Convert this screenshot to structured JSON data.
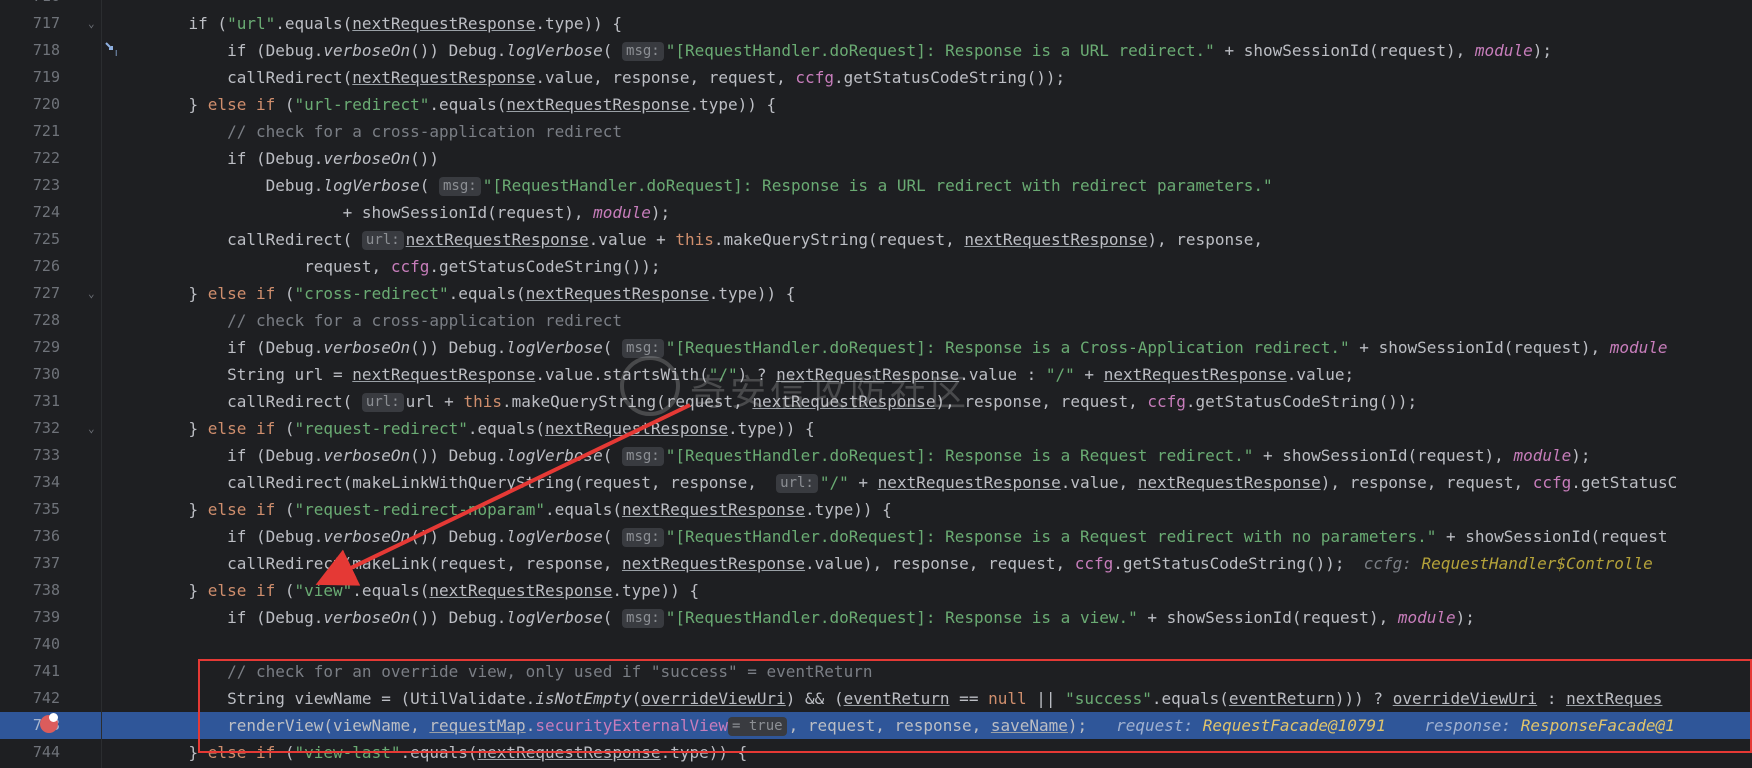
{
  "editor": {
    "lines": [
      {
        "n": "717",
        "segs": [
          [
            "",
            "    if ("
          ],
          [
            "str",
            "\"url\""
          ],
          [
            "",
            ".equals("
          ],
          [
            "u",
            "nextRequestResponse"
          ],
          [
            "",
            ".type)) {"
          ]
        ]
      },
      {
        "n": "718",
        "segs": [
          [
            "",
            "        if (Debug."
          ],
          [
            "ital",
            "verboseOn"
          ],
          [
            "",
            "()) Debug."
          ],
          [
            "ital",
            "logVerbose"
          ],
          [
            "",
            "( "
          ],
          [
            "hint",
            "msg:"
          ],
          [
            "str",
            "\"[RequestHandler.doRequest]: Response is a URL redirect.\""
          ],
          [
            "",
            " + showSessionId(request), "
          ],
          [
            "fld ital",
            "module"
          ],
          [
            "",
            ");"
          ]
        ]
      },
      {
        "n": "719",
        "segs": [
          [
            "",
            "        callRedirect("
          ],
          [
            "u",
            "nextRequestResponse"
          ],
          [
            "",
            ".value, response, request, "
          ],
          [
            "fld",
            "ccfg"
          ],
          [
            "",
            ".getStatusCodeString());"
          ]
        ]
      },
      {
        "n": "720",
        "segs": [
          [
            "",
            "    } "
          ],
          [
            "kw",
            "else if"
          ],
          [
            "",
            " ("
          ],
          [
            "str",
            "\"url-redirect\""
          ],
          [
            "",
            ".equals("
          ],
          [
            "u",
            "nextRequestResponse"
          ],
          [
            "",
            ".type)) {"
          ]
        ]
      },
      {
        "n": "721",
        "segs": [
          [
            "cm",
            "        // check for a cross-application redirect"
          ]
        ]
      },
      {
        "n": "722",
        "segs": [
          [
            "",
            "        if (Debug."
          ],
          [
            "ital",
            "verboseOn"
          ],
          [
            "",
            "())"
          ]
        ]
      },
      {
        "n": "723",
        "segs": [
          [
            "",
            "            Debug."
          ],
          [
            "ital",
            "logVerbose"
          ],
          [
            "",
            "( "
          ],
          [
            "hint",
            "msg:"
          ],
          [
            "str",
            "\"[RequestHandler.doRequest]: Response is a URL redirect with redirect parameters.\""
          ]
        ]
      },
      {
        "n": "724",
        "segs": [
          [
            "",
            "                    + showSessionId(request), "
          ],
          [
            "fld ital",
            "module"
          ],
          [
            "",
            ");"
          ]
        ]
      },
      {
        "n": "725",
        "segs": [
          [
            "",
            "        callRedirect( "
          ],
          [
            "hint",
            "url:"
          ],
          [
            "u",
            "nextRequestResponse"
          ],
          [
            "",
            ".value + "
          ],
          [
            "kw",
            "this"
          ],
          [
            "",
            ".makeQueryString(request, "
          ],
          [
            "u",
            "nextRequestResponse"
          ],
          [
            "",
            "), response,"
          ]
        ]
      },
      {
        "n": "726",
        "segs": [
          [
            "",
            "                request, "
          ],
          [
            "fld",
            "ccfg"
          ],
          [
            "",
            ".getStatusCodeString());"
          ]
        ]
      },
      {
        "n": "727",
        "segs": [
          [
            "",
            "    } "
          ],
          [
            "kw",
            "else if"
          ],
          [
            "",
            " ("
          ],
          [
            "str",
            "\"cross-redirect\""
          ],
          [
            "",
            ".equals("
          ],
          [
            "u",
            "nextRequestResponse"
          ],
          [
            "",
            ".type)) {"
          ]
        ]
      },
      {
        "n": "728",
        "segs": [
          [
            "cm",
            "        // check for a cross-application redirect"
          ]
        ]
      },
      {
        "n": "729",
        "segs": [
          [
            "",
            "        if (Debug."
          ],
          [
            "ital",
            "verboseOn"
          ],
          [
            "",
            "()) Debug."
          ],
          [
            "ital",
            "logVerbose"
          ],
          [
            "",
            "( "
          ],
          [
            "hint",
            "msg:"
          ],
          [
            "str",
            "\"[RequestHandler.doRequest]: Response is a Cross-Application redirect.\""
          ],
          [
            "",
            " + showSessionId(request), "
          ],
          [
            "fld ital",
            "module"
          ]
        ]
      },
      {
        "n": "730",
        "segs": [
          [
            "",
            "        String url = "
          ],
          [
            "u",
            "nextRequestResponse"
          ],
          [
            "",
            ".value.startsWith("
          ],
          [
            "str",
            "\"/\""
          ],
          [
            "",
            ") ? "
          ],
          [
            "u",
            "nextRequestResponse"
          ],
          [
            "",
            ".value : "
          ],
          [
            "str",
            "\"/\""
          ],
          [
            "",
            " + "
          ],
          [
            "u",
            "nextRequestResponse"
          ],
          [
            "",
            ".value;"
          ]
        ]
      },
      {
        "n": "731",
        "segs": [
          [
            "",
            "        callRedirect( "
          ],
          [
            "hint",
            "url:"
          ],
          [
            "",
            "url + "
          ],
          [
            "kw",
            "this"
          ],
          [
            "",
            ".makeQueryString(request, "
          ],
          [
            "u",
            "nextRequestResponse"
          ],
          [
            "",
            "), response, request, "
          ],
          [
            "fld",
            "ccfg"
          ],
          [
            "",
            ".getStatusCodeString());"
          ]
        ]
      },
      {
        "n": "732",
        "segs": [
          [
            "",
            "    } "
          ],
          [
            "kw",
            "else if"
          ],
          [
            "",
            " ("
          ],
          [
            "str",
            "\"request-redirect\""
          ],
          [
            "",
            ".equals("
          ],
          [
            "u",
            "nextRequestResponse"
          ],
          [
            "",
            ".type)) {"
          ]
        ]
      },
      {
        "n": "733",
        "segs": [
          [
            "",
            "        if (Debug."
          ],
          [
            "ital",
            "verboseOn"
          ],
          [
            "",
            "()) Debug."
          ],
          [
            "ital",
            "logVerbose"
          ],
          [
            "",
            "( "
          ],
          [
            "hint",
            "msg:"
          ],
          [
            "str",
            "\"[RequestHandler.doRequest]: Response is a Request redirect.\""
          ],
          [
            "",
            " + showSessionId(request), "
          ],
          [
            "fld ital",
            "module"
          ],
          [
            "",
            ");"
          ]
        ]
      },
      {
        "n": "734",
        "segs": [
          [
            "",
            "        callRedirect(makeLinkWithQueryString(request, response,  "
          ],
          [
            "hint",
            "url:"
          ],
          [
            "str",
            "\"/\""
          ],
          [
            "",
            " + "
          ],
          [
            "u",
            "nextRequestResponse"
          ],
          [
            "",
            ".value, "
          ],
          [
            "u",
            "nextRequestResponse"
          ],
          [
            "",
            "), response, request, "
          ],
          [
            "fld",
            "ccfg"
          ],
          [
            "",
            ".getStatusC"
          ]
        ]
      },
      {
        "n": "735",
        "segs": [
          [
            "",
            "    } "
          ],
          [
            "kw",
            "else if"
          ],
          [
            "",
            " ("
          ],
          [
            "str",
            "\"request-redirect-noparam\""
          ],
          [
            "",
            ".equals("
          ],
          [
            "u",
            "nextRequestResponse"
          ],
          [
            "",
            ".type)) {"
          ]
        ]
      },
      {
        "n": "736",
        "segs": [
          [
            "",
            "        if (Debug."
          ],
          [
            "ital",
            "verboseOn"
          ],
          [
            "",
            "()) Debug."
          ],
          [
            "ital",
            "logVerbose"
          ],
          [
            "",
            "( "
          ],
          [
            "hint",
            "msg:"
          ],
          [
            "str",
            "\"[RequestHandler.doRequest]: Response is a Request redirect with no parameters.\""
          ],
          [
            "",
            " + showSessionId(request"
          ]
        ]
      },
      {
        "n": "737",
        "segs": [
          [
            "",
            "        callRedirect(makeLink(request, response, "
          ],
          [
            "u",
            "nextRequestResponse"
          ],
          [
            "",
            ".value), response, request, "
          ],
          [
            "fld",
            "ccfg"
          ],
          [
            "",
            ".getStatusCodeString());  "
          ],
          [
            "dbg",
            "ccfg: "
          ],
          [
            "dbgv",
            "RequestHandler$Controlle"
          ]
        ]
      },
      {
        "n": "738",
        "segs": [
          [
            "",
            "    } "
          ],
          [
            "kw",
            "else if"
          ],
          [
            "",
            " ("
          ],
          [
            "str",
            "\"view\""
          ],
          [
            "",
            ".equals("
          ],
          [
            "u",
            "nextRequestResponse"
          ],
          [
            "",
            ".type)) {"
          ]
        ]
      },
      {
        "n": "739",
        "segs": [
          [
            "",
            "        if (Debug."
          ],
          [
            "ital",
            "verboseOn"
          ],
          [
            "",
            "()) Debug."
          ],
          [
            "ital",
            "logVerbose"
          ],
          [
            "",
            "( "
          ],
          [
            "hint",
            "msg:"
          ],
          [
            "str",
            "\"[RequestHandler.doRequest]: Response is a view.\""
          ],
          [
            "",
            " + showSessionId(request), "
          ],
          [
            "fld ital",
            "module"
          ],
          [
            "",
            ");"
          ]
        ]
      },
      {
        "n": "740",
        "segs": []
      },
      {
        "n": "741",
        "segs": [
          [
            "cm",
            "        // check for an override view, only used if \"success\" = eventReturn"
          ]
        ]
      },
      {
        "n": "742",
        "segs": [
          [
            "",
            "        String viewName = (UtilValidate."
          ],
          [
            "ital",
            "isNotEmpty"
          ],
          [
            "",
            "("
          ],
          [
            "u",
            "overrideViewUri"
          ],
          [
            "",
            ") && ("
          ],
          [
            "u",
            "eventReturn"
          ],
          [
            "",
            " == "
          ],
          [
            "kw",
            "null"
          ],
          [
            "",
            " || "
          ],
          [
            "str",
            "\"success\""
          ],
          [
            "",
            ".equals("
          ],
          [
            "u",
            "eventReturn"
          ],
          [
            "",
            ")))"
          ],
          [
            "",
            " ? "
          ],
          [
            "u",
            "overrideViewUri"
          ],
          [
            "",
            " : "
          ],
          [
            "u",
            "nextReques"
          ]
        ]
      },
      {
        "n": "743",
        "segs": [
          [
            "",
            "        renderView(viewName, "
          ],
          [
            "u",
            "requestMap"
          ],
          [
            "",
            "."
          ],
          [
            "fld",
            "securityExternalView"
          ],
          [
            "hint",
            "= true"
          ],
          [
            "",
            ", request, response, "
          ],
          [
            "u",
            "saveName"
          ],
          [
            "",
            ");   "
          ],
          [
            "dbg",
            "request: "
          ],
          [
            "dbgv",
            "RequestFacade@10791"
          ],
          [
            "",
            "    "
          ],
          [
            "dbg",
            "response: "
          ],
          [
            "dbgv",
            "ResponseFacade@1"
          ]
        ]
      },
      {
        "n": "744",
        "segs": [
          [
            "",
            "    } "
          ],
          [
            "kw",
            "else if"
          ],
          [
            "",
            " ("
          ],
          [
            "str",
            "\"view-last\""
          ],
          [
            "",
            ".equals("
          ],
          [
            "u",
            "nextRequestResponse"
          ],
          [
            "",
            ".type)) {"
          ]
        ]
      }
    ],
    "partial_top_line": "716",
    "watermark_text": "奇安信攻防社区",
    "annotation": {
      "box_color": "#e53935",
      "arrow_color": "#e53935"
    }
  }
}
